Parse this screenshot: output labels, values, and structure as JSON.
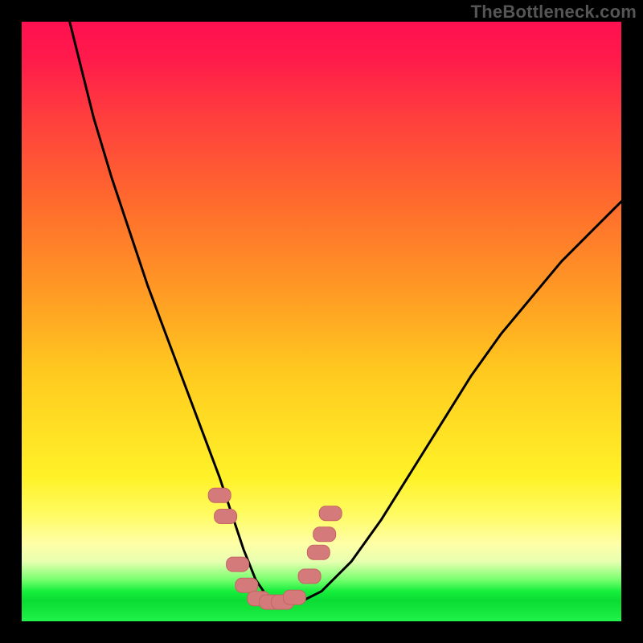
{
  "watermark": {
    "text": "TheBottleneck.com"
  },
  "colors": {
    "curve_stroke": "#000000",
    "marker_fill": "#d47a7a",
    "marker_stroke": "#c76464",
    "gradient_top": "#ff1050",
    "gradient_mid": "#ffe024",
    "gradient_bottom": "#16ef3c",
    "frame": "#000000"
  },
  "chart_data": {
    "type": "line",
    "title": "",
    "xlabel": "",
    "ylabel": "",
    "x_range": [
      0,
      100
    ],
    "y_range": [
      0,
      100
    ],
    "series": [
      {
        "name": "bottleneck-curve",
        "x": [
          8,
          10,
          12,
          15,
          18,
          21,
          24,
          27,
          30,
          33,
          35,
          37,
          39,
          41,
          43,
          46,
          50,
          55,
          60,
          65,
          70,
          75,
          80,
          85,
          90,
          95,
          100
        ],
        "y": [
          100,
          92,
          84,
          74,
          65,
          56,
          48,
          40,
          32,
          24,
          18,
          12,
          7,
          4,
          3,
          3,
          5,
          10,
          17,
          25,
          33,
          41,
          48,
          54,
          60,
          65,
          70
        ]
      }
    ],
    "markers": [
      {
        "x": 33.0,
        "y": 21.0
      },
      {
        "x": 34.0,
        "y": 17.5
      },
      {
        "x": 36.0,
        "y": 9.5
      },
      {
        "x": 37.5,
        "y": 6.0
      },
      {
        "x": 39.5,
        "y": 3.8
      },
      {
        "x": 41.5,
        "y": 3.2
      },
      {
        "x": 43.5,
        "y": 3.2
      },
      {
        "x": 45.5,
        "y": 4.0
      },
      {
        "x": 48.0,
        "y": 7.5
      },
      {
        "x": 49.5,
        "y": 11.5
      },
      {
        "x": 50.5,
        "y": 14.5
      },
      {
        "x": 51.5,
        "y": 18.0
      }
    ],
    "gradient_meaning": "vertical position maps to bottleneck severity: top = worst (red), bottom = best (green)"
  }
}
